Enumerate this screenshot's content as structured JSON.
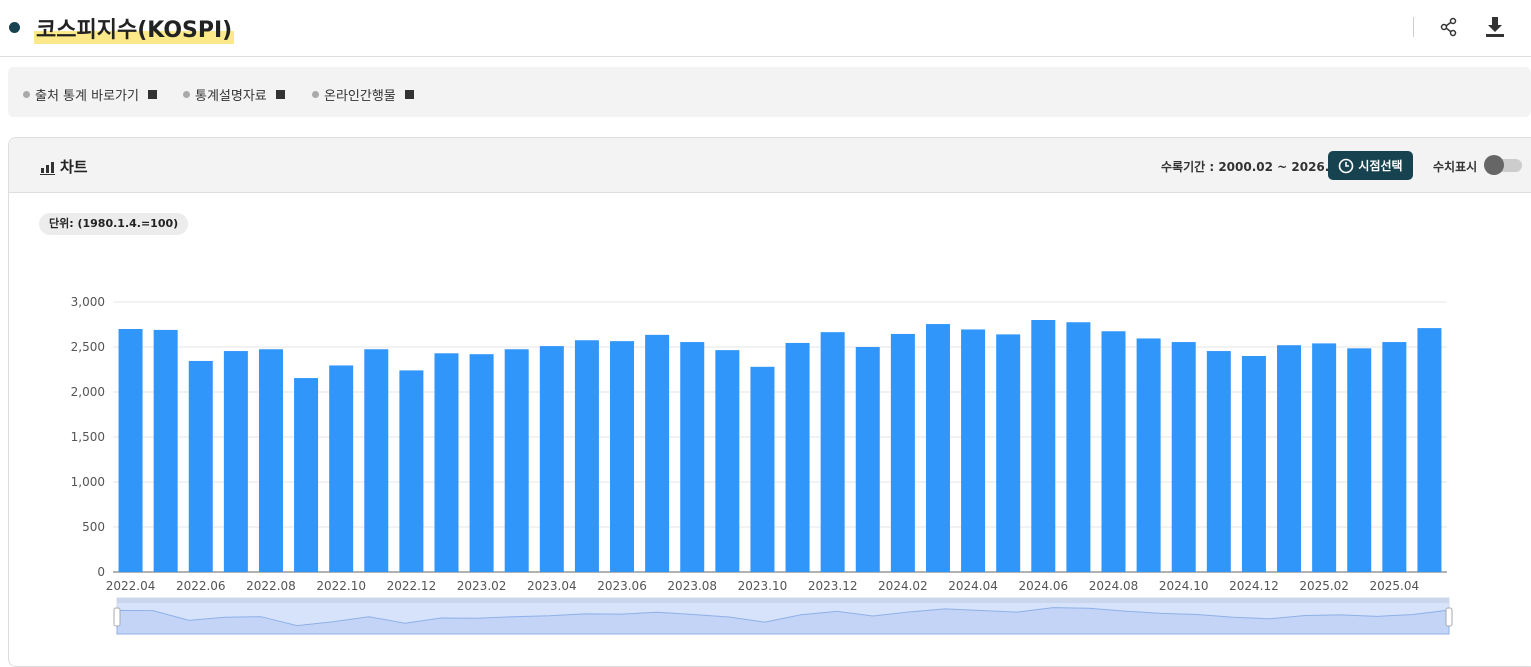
{
  "header": {
    "title": "코스피지수(KOSPI)",
    "share_icon": "share-icon",
    "download_icon": "download-icon"
  },
  "links": [
    {
      "label": "출처 통계 바로가기"
    },
    {
      "label": "통계설명자료"
    },
    {
      "label": "온라인간행물"
    }
  ],
  "card": {
    "title": "차트",
    "period": "수록기간 : 2000.02 ~ 2026.01",
    "select_button": "시점선택",
    "show_values_label": "수치표시",
    "show_values_on": false,
    "unit": "단위: (1980.1.4.=100)"
  },
  "colors": {
    "bar": "#3096fa",
    "accent": "#16434f"
  },
  "chart_data": {
    "type": "bar",
    "categories": [
      "2022.04",
      "2022.05",
      "2022.06",
      "2022.07",
      "2022.08",
      "2022.09",
      "2022.10",
      "2022.11",
      "2022.12",
      "2023.01",
      "2023.02",
      "2023.03",
      "2023.04",
      "2023.05",
      "2023.06",
      "2023.07",
      "2023.08",
      "2023.09",
      "2023.10",
      "2023.11",
      "2023.12",
      "2024.01",
      "2024.02",
      "2024.03",
      "2024.04",
      "2024.05",
      "2024.06",
      "2024.07",
      "2024.08",
      "2024.09",
      "2024.10",
      "2024.11",
      "2024.12",
      "2025.01",
      "2025.02",
      "2025.03",
      "2025.04",
      "2025.05"
    ],
    "values": [
      2700,
      2690,
      2345,
      2455,
      2475,
      2155,
      2295,
      2475,
      2240,
      2430,
      2420,
      2475,
      2510,
      2575,
      2565,
      2635,
      2555,
      2465,
      2280,
      2545,
      2665,
      2500,
      2645,
      2755,
      2695,
      2640,
      2800,
      2775,
      2675,
      2595,
      2555,
      2455,
      2400,
      2520,
      2540,
      2485,
      2555,
      2710
    ],
    "yticks": [
      "0",
      "500",
      "1,000",
      "1,500",
      "2,000",
      "2,500",
      "3,000"
    ],
    "ylim": [
      0,
      3000
    ],
    "xlabel": "",
    "ylabel": "",
    "grid": true,
    "legend": "none"
  }
}
